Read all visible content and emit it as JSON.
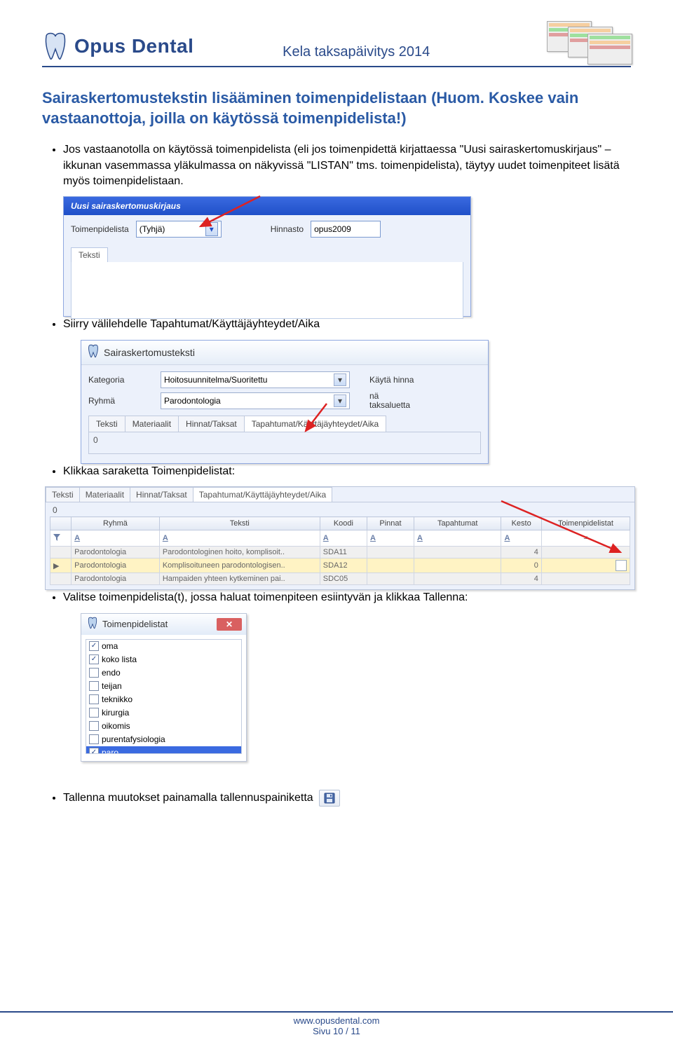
{
  "header": {
    "brand": "Opus Dental",
    "title": "Kela taksapäivitys 2014"
  },
  "doc": {
    "heading": "Sairaskertomustekstin lisääminen toimenpidelistaan (Huom. Koskee vain vastaanottoja, joilla on käytössä toimenpidelista!)",
    "bullet1": "Jos vastaanotolla on käytössä toimenpidelista (eli jos toimenpidettä kirjattaessa \"Uusi sairaskertomuskirjaus\" –ikkunan vasemmassa yläkulmassa on näkyvissä \"LISTAN\" tms. toimenpidelista), täytyy uudet toimenpiteet lisätä myös toimenpidelistaan.",
    "bullet2": "Siirry välilehdelle Tapahtumat/Käyttäjäyhteydet/Aika",
    "bullet3": "Klikkaa saraketta Toimenpidelistat:",
    "bullet4": "Valitse toimenpidelista(t), jossa haluat toimenpiteen esiintyvän ja klikkaa Tallenna:",
    "bullet5": "Tallenna muutokset painamalla tallennuspainiketta"
  },
  "shot1": {
    "windowTitle": "Uusi sairaskertomuskirjaus",
    "toimenpidelista_label": "Toimenpidelista",
    "toimenpidelista_value": "(Tyhjä)",
    "hinnasto_label": "Hinnasto",
    "hinnasto_value": "opus2009",
    "teksti_tab": "Teksti"
  },
  "shot2": {
    "windowTitle": "Sairaskertomusteksti",
    "kategoria_label": "Kategoria",
    "kategoria_value": "Hoitosuunnitelma/Suoritettu",
    "ryhma_label": "Ryhmä",
    "ryhma_value": "Parodontologia",
    "right1": "Käytä hinna",
    "right2_line1": "nä",
    "right2_line2": "taksaluetta",
    "tabs": [
      "Teksti",
      "Materiaalit",
      "Hinnat/Taksat",
      "Tapahtumat/Käyttäjäyhteydet/Aika"
    ],
    "active_tab_index": 3,
    "below_value": "0"
  },
  "shot3": {
    "tabs": [
      "Teksti",
      "Materiaalit",
      "Hinnat/Taksat",
      "Tapahtumat/Käyttäjäyhteydet/Aika"
    ],
    "active_tab_index": 3,
    "under_value": "0",
    "columns": [
      "",
      "Ryhmä",
      "Teksti",
      "Koodi",
      "Pinnat",
      "Tapahtumat",
      "Kesto",
      "Toimenpidelistat"
    ],
    "filter_eq": "=",
    "rows": [
      {
        "marker": "",
        "ryhma": "Parodontologia",
        "teksti": "Parodontologinen hoito, komplisoit..",
        "koodi": "SDA11",
        "pinnat": "",
        "tap": "",
        "kesto": "4",
        "tpl": "",
        "hl": false
      },
      {
        "marker": "▶",
        "ryhma": "Parodontologia",
        "teksti": "Komplisoituneen parodontologisen..",
        "koodi": "SDA12",
        "pinnat": "",
        "tap": "",
        "kesto": "0",
        "tpl": "",
        "hl": true
      },
      {
        "marker": "",
        "ryhma": "Parodontologia",
        "teksti": "Hampaiden yhteen kytkeminen pai..",
        "koodi": "SDC05",
        "pinnat": "",
        "tap": "",
        "kesto": "4",
        "tpl": "",
        "hl": false
      }
    ]
  },
  "shot4": {
    "title": "Toimenpidelistat",
    "items": [
      {
        "label": "oma",
        "checked": true,
        "selected": false
      },
      {
        "label": "koko lista",
        "checked": true,
        "selected": false
      },
      {
        "label": "endo",
        "checked": false,
        "selected": false
      },
      {
        "label": "teijan",
        "checked": false,
        "selected": false
      },
      {
        "label": "teknikko",
        "checked": false,
        "selected": false
      },
      {
        "label": "kirurgia",
        "checked": false,
        "selected": false
      },
      {
        "label": "oikomis",
        "checked": false,
        "selected": false
      },
      {
        "label": "purentafysiologia",
        "checked": false,
        "selected": false
      },
      {
        "label": "paro",
        "checked": true,
        "selected": true
      }
    ]
  },
  "footer": {
    "url": "www.opusdental.com",
    "page": "Sivu 10 / 11"
  }
}
